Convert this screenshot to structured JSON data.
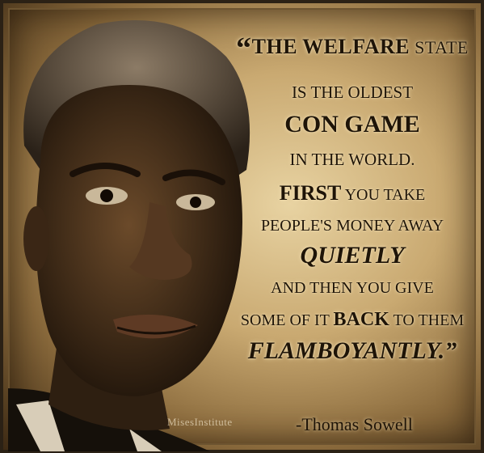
{
  "quote": {
    "line1_open": "“",
    "line1_the": "The",
    "line1_welfare": "WELFARE",
    "line1_state": "state",
    "line2": "is the oldest",
    "line3": "CON GAME",
    "line4": "in the world.",
    "line5_first": "First",
    "line5_rest": "you take",
    "line6": "people's money away",
    "line7": "QUIETLY",
    "line8": "and then you give",
    "line9_pre": "some of it",
    "line9_back": "BACK",
    "line9_post": "to them",
    "line10": "FLAMBOYANTLY.”"
  },
  "author": "-Thomas Sowell",
  "logo_text": "MisesInstitute",
  "colors": {
    "background_light": "#e8d3a2",
    "background_dark": "#3d2a14",
    "text": "#1e1408",
    "border": "#2b2115"
  }
}
